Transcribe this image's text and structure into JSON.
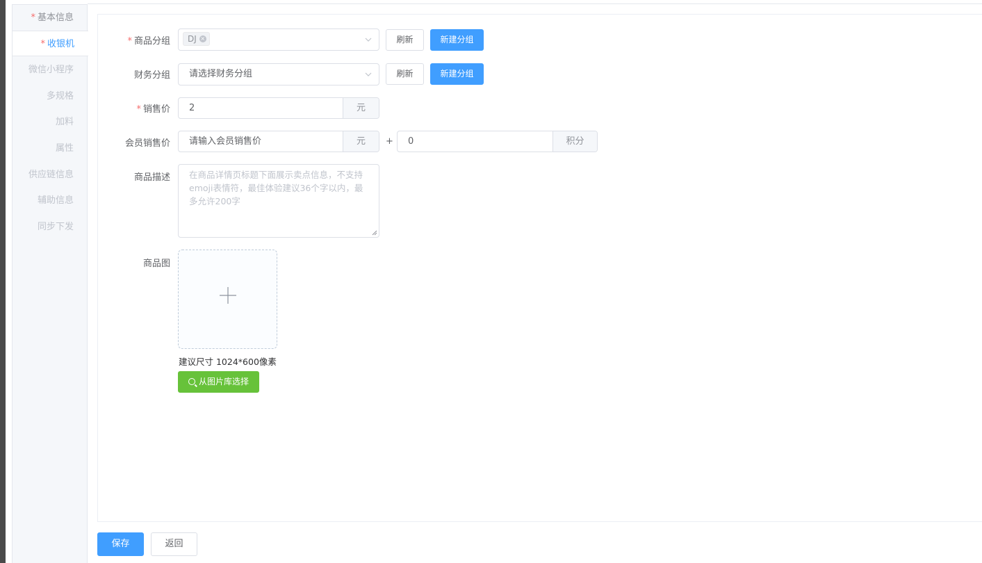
{
  "sidebar": {
    "items": [
      {
        "label": "基本信息",
        "required": true
      },
      {
        "label": "收银机",
        "required": true
      },
      {
        "label": "微信小程序",
        "required": false
      },
      {
        "label": "多规格",
        "required": false
      },
      {
        "label": "加料",
        "required": false
      },
      {
        "label": "属性",
        "required": false
      },
      {
        "label": "供应链信息",
        "required": false
      },
      {
        "label": "辅助信息",
        "required": false
      },
      {
        "label": "同步下发",
        "required": false
      }
    ],
    "required_mark": "*"
  },
  "form": {
    "product_group": {
      "label": "商品分组",
      "tag": "DJ",
      "refresh": "刷新",
      "new_group": "新建分组"
    },
    "finance_group": {
      "label": "财务分组",
      "placeholder": "请选择财务分组",
      "refresh": "刷新",
      "new_group": "新建分组"
    },
    "sale_price": {
      "label": "销售价",
      "value": "2",
      "unit": "元"
    },
    "member_price": {
      "label": "会员销售价",
      "placeholder": "请输入会员销售价",
      "unit": "元",
      "plus": "+",
      "points_value": "0",
      "points_unit": "积分"
    },
    "description": {
      "label": "商品描述",
      "placeholder": "在商品详情页标题下面展示卖点信息，不支持emoji表情符，最佳体验建议36个字以内，最多允许200字"
    },
    "image": {
      "label": "商品图",
      "hint": "建议尺寸 1024*600像素",
      "library_button": "从图片库选择"
    }
  },
  "footer": {
    "save": "保存",
    "back": "返回"
  },
  "colors": {
    "primary": "#409eff",
    "success": "#67c23a",
    "required": "#f56c6c"
  }
}
